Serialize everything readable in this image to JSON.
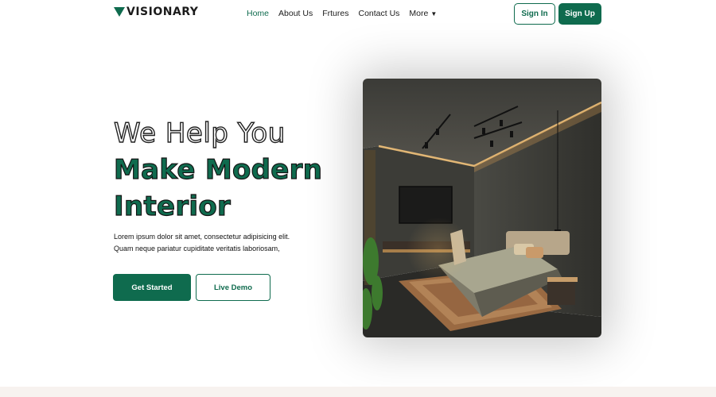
{
  "brand": {
    "name": "VISIONARY",
    "color": "#0f6b4e"
  },
  "nav": {
    "items": [
      {
        "label": "Home",
        "active": true
      },
      {
        "label": "About Us",
        "active": false
      },
      {
        "label": "Frtures",
        "active": false
      },
      {
        "label": "Contact Us",
        "active": false
      },
      {
        "label": "More",
        "active": false,
        "icon": "caret-down-icon"
      }
    ],
    "sign_in": "Sign In",
    "sign_up": "Sign Up"
  },
  "hero": {
    "title_line1": "We Help You",
    "title_line2": "Make Modern",
    "title_line3": "Interior",
    "description_line1": "Lorem ipsum dolor sit amet, consectetur adipisicing elit.",
    "description_line2": "Quam neque pariatur cupiditate veritatis laboriosam,",
    "cta_primary": "Get Started",
    "cta_secondary": "Live Demo"
  },
  "colors": {
    "accent": "#0f6b4e",
    "footer_bg": "#f7f2ef"
  }
}
